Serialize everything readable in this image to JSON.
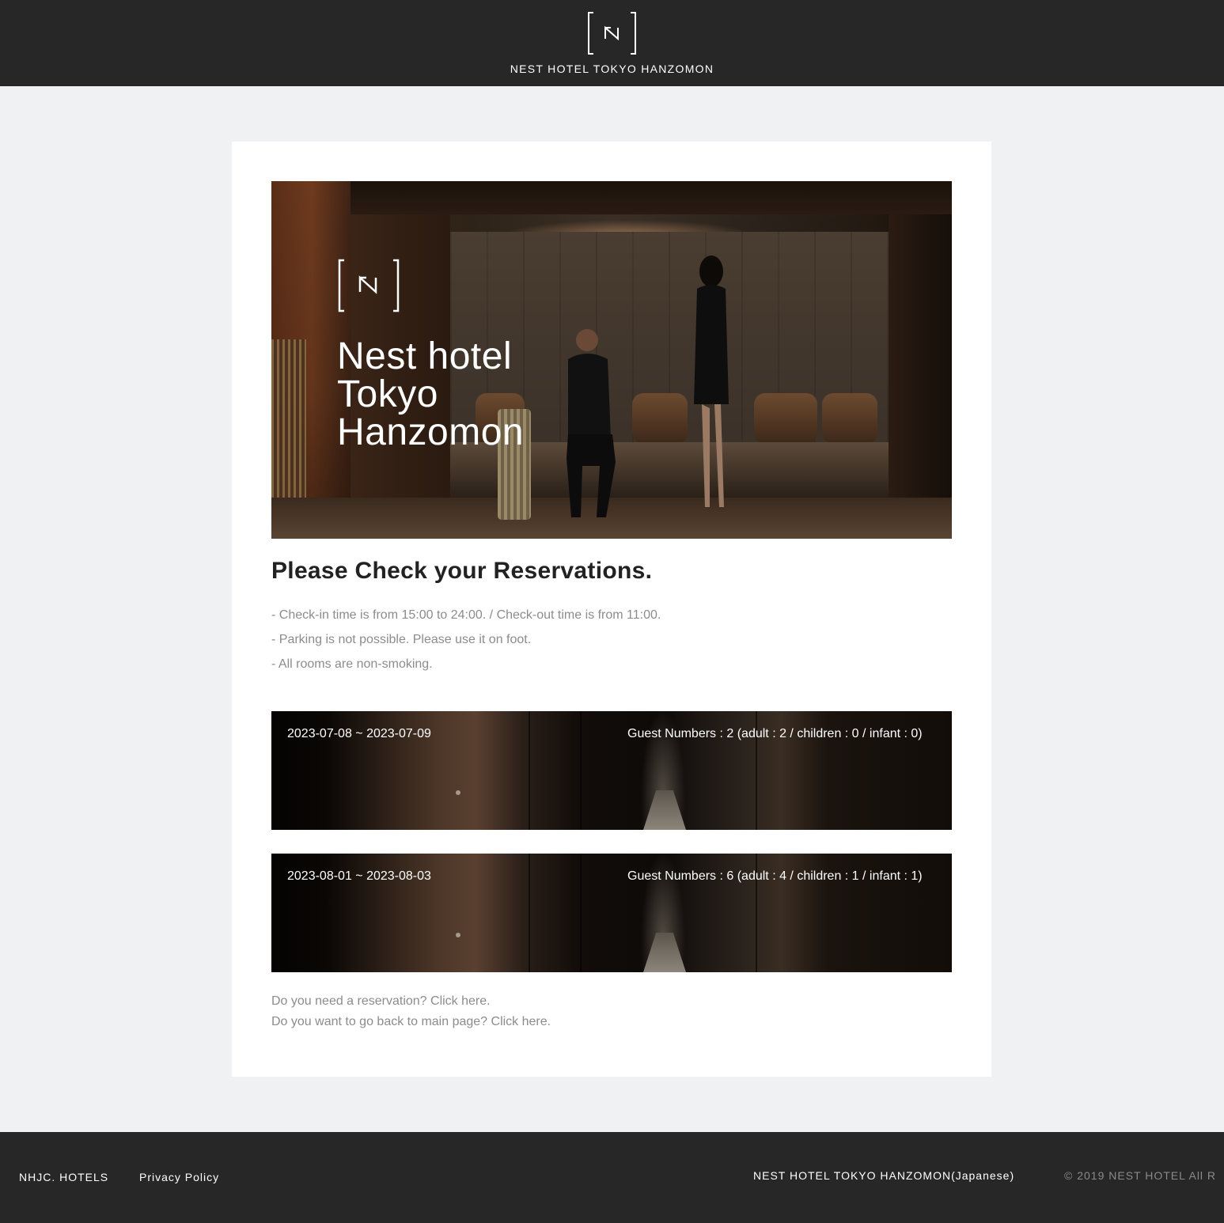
{
  "header": {
    "title": "NEST HOTEL TOKYO HANZOMON"
  },
  "hero": {
    "title_lines": [
      "Nest hotel",
      "Tokyo",
      "Hanzomon"
    ]
  },
  "main": {
    "heading": "Please Check your Reservations.",
    "notes": [
      "- Check-in time is from 15:00 to 24:00. / Check-out time is from 11:00.",
      "- Parking is not possible. Please use it on foot.",
      "- All rooms are non-smoking."
    ],
    "reservations": [
      {
        "dates": "2023-07-08 ~ 2023-07-09",
        "guests": "Guest Numbers : 2 (adult : 2 / children : 0 / infant : 0)"
      },
      {
        "dates": "2023-08-01 ~ 2023-08-03",
        "guests": "Guest Numbers : 6 (adult : 4 / children : 1 / infant : 1)"
      }
    ],
    "links": {
      "new_reservation": "Do you need a reservation? Click here.",
      "main_page": "Do you want to go back to main page? Click here."
    }
  },
  "footer": {
    "nhjc": "NHJC. HOTELS",
    "privacy": "Privacy Policy",
    "japanese": "NEST HOTEL TOKYO HANZOMON(Japanese)",
    "copyright": "© 2019 NEST HOTEL All R"
  },
  "colors": {
    "header_bg": "#272727",
    "page_bg": "#f0f1f2",
    "card_bg": "#ffffff",
    "heading": "#222222",
    "muted_text": "#8c8c8c"
  }
}
